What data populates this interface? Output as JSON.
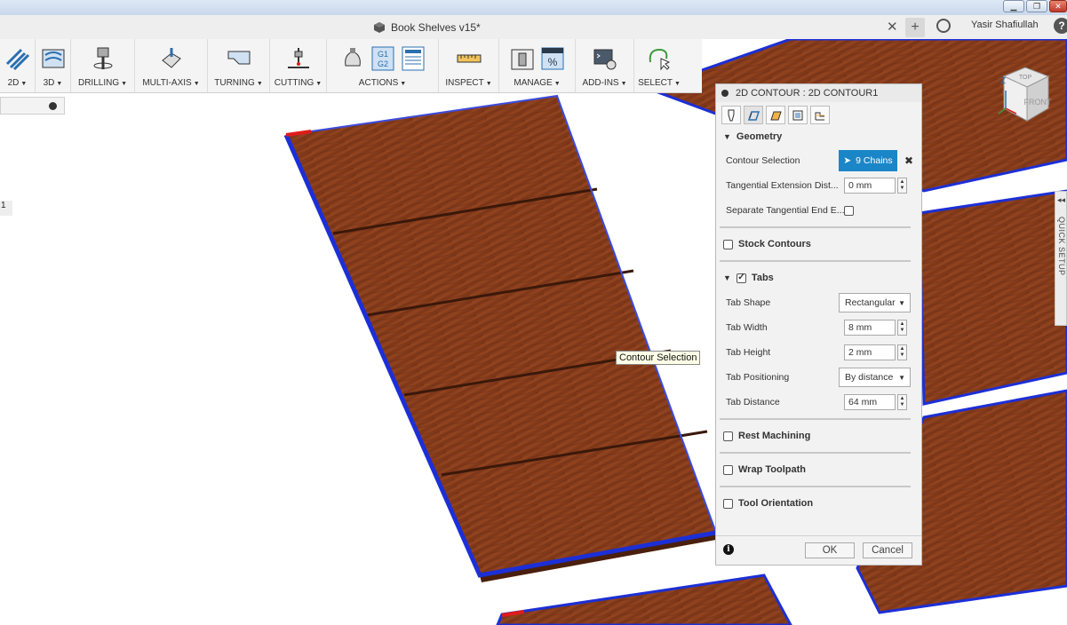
{
  "document": {
    "title": "Book Shelves v15*",
    "user": "Yasir Shafiullah"
  },
  "toolbar": {
    "groups": [
      "2D",
      "3D",
      "DRILLING",
      "MULTI-AXIS",
      "TURNING",
      "CUTTING",
      "ACTIONS",
      "INSPECT",
      "MANAGE",
      "ADD-INS",
      "SELECT"
    ],
    "actions_g1": "G1",
    "actions_g2": "G2",
    "manage_percent": "%"
  },
  "browser": {
    "side_number": "1"
  },
  "tooltip": "Contour Selection",
  "viewcube": {
    "top": "TOP",
    "front": "FRONT",
    "z": "Z"
  },
  "quick_setup": "QUICK SETUP",
  "dialog": {
    "title": "2D CONTOUR : 2D CONTOUR1",
    "geometry": {
      "header": "Geometry",
      "contour_selection_label": "Contour Selection",
      "contour_selection_value": "9 Chains",
      "tangential_extension_label": "Tangential Extension Dist...",
      "tangential_extension_value": "0 mm",
      "separate_tangential_label": "Separate Tangential End E..."
    },
    "stock_contours": "Stock Contours",
    "tabs": {
      "header": "Tabs",
      "checked": true,
      "tab_shape_label": "Tab Shape",
      "tab_shape_value": "Rectangular",
      "tab_width_label": "Tab Width",
      "tab_width_value": "8 mm",
      "tab_height_label": "Tab Height",
      "tab_height_value": "2 mm",
      "tab_positioning_label": "Tab Positioning",
      "tab_positioning_value": "By distance",
      "tab_distance_label": "Tab Distance",
      "tab_distance_value": "64 mm"
    },
    "rest_machining": "Rest Machining",
    "wrap_toolpath": "Wrap Toolpath",
    "tool_orientation": "Tool Orientation",
    "ok": "OK",
    "cancel": "Cancel"
  },
  "colors": {
    "accent": "#1a86c8",
    "wood": "#8a3f1c",
    "chain": "#1c2fd6"
  }
}
